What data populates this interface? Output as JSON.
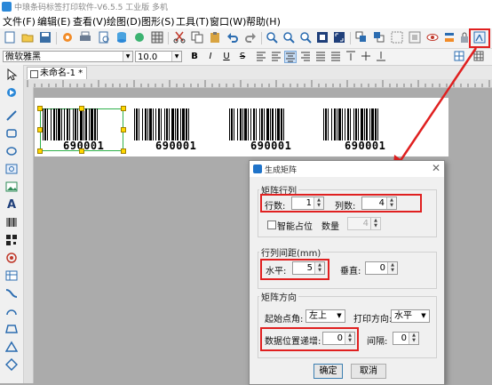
{
  "window": {
    "title": "中琅条码标签打印软件-V6.5.5 工业版 多机"
  },
  "menu": [
    "文件(F)",
    "编辑(E)",
    "查看(V)",
    "绘图(D)",
    "图形(S)",
    "工具(T)",
    "窗口(W)",
    "帮助(H)"
  ],
  "fontbar": {
    "font_name": "微软雅黑",
    "font_size": "10.0",
    "bold": "B",
    "italic": "I",
    "underline": "U",
    "strike": "S"
  },
  "document": {
    "tab_label": "未命名-1 *"
  },
  "barcodes": [
    "690001",
    "690001",
    "690001",
    "690001"
  ],
  "dialog": {
    "title": "生成矩阵",
    "close": "✕",
    "matrix_group": "矩阵行列",
    "rows_label": "行数:",
    "rows_value": "1",
    "cols_label": "列数:",
    "cols_value": "4",
    "smart_label": "智能占位",
    "count_label": "数量",
    "count_value": "4",
    "spacing_group": "行列间距(mm)",
    "horizontal_label": "水平:",
    "horizontal_value": "5",
    "vertical_label": "垂直:",
    "vertical_value": "0",
    "direction_group": "矩阵方向",
    "start_label": "起始点角:",
    "start_value": "左上",
    "print_dir_label": "打印方向:",
    "print_dir_value": "水平",
    "increment_label": "数据位置递增:",
    "increment_value": "0",
    "gap_label": "间隔:",
    "gap_value": "0",
    "ok": "确定",
    "cancel": "取消"
  },
  "colors": {
    "highlight": "#e02020",
    "accent": "#2b88d8",
    "selection": "#ffd800"
  }
}
